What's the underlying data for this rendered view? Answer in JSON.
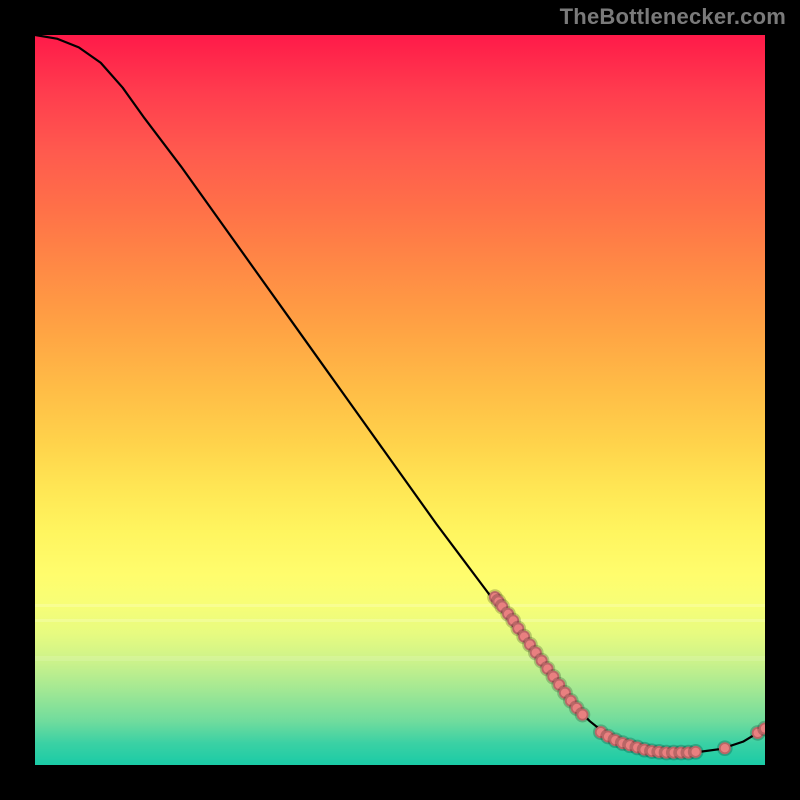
{
  "watermark": {
    "text": "TheBottlenecker.com"
  },
  "plot": {
    "width_units": 100,
    "height_units": 100
  },
  "chart_data": {
    "type": "line",
    "title": "",
    "xlabel": "",
    "ylabel": "",
    "xlim": [
      0,
      100
    ],
    "ylim": [
      0,
      100
    ],
    "background": "spectral-vertical-red-to-green",
    "curve": [
      {
        "x": 0,
        "y": 100.0
      },
      {
        "x": 3,
        "y": 99.5
      },
      {
        "x": 6,
        "y": 98.3
      },
      {
        "x": 9,
        "y": 96.2
      },
      {
        "x": 12,
        "y": 92.8
      },
      {
        "x": 15,
        "y": 88.6
      },
      {
        "x": 20,
        "y": 82.0
      },
      {
        "x": 25,
        "y": 75.0
      },
      {
        "x": 30,
        "y": 68.0
      },
      {
        "x": 35,
        "y": 61.0
      },
      {
        "x": 40,
        "y": 54.0
      },
      {
        "x": 45,
        "y": 47.0
      },
      {
        "x": 50,
        "y": 40.0
      },
      {
        "x": 55,
        "y": 33.0
      },
      {
        "x": 58,
        "y": 29.0
      },
      {
        "x": 61,
        "y": 25.0
      },
      {
        "x": 64,
        "y": 21.0
      },
      {
        "x": 67,
        "y": 17.0
      },
      {
        "x": 70,
        "y": 13.0
      },
      {
        "x": 73,
        "y": 9.0
      },
      {
        "x": 76,
        "y": 6.0
      },
      {
        "x": 79,
        "y": 3.6
      },
      {
        "x": 82,
        "y": 2.4
      },
      {
        "x": 85,
        "y": 1.8
      },
      {
        "x": 88,
        "y": 1.7
      },
      {
        "x": 91,
        "y": 1.8
      },
      {
        "x": 94,
        "y": 2.2
      },
      {
        "x": 97,
        "y": 3.2
      },
      {
        "x": 100,
        "y": 5.0
      }
    ],
    "scatter": [
      {
        "x": 63.0,
        "y": 23.0
      },
      {
        "x": 63.5,
        "y": 22.4
      },
      {
        "x": 64.0,
        "y": 21.7
      },
      {
        "x": 64.8,
        "y": 20.7
      },
      {
        "x": 65.5,
        "y": 19.8
      },
      {
        "x": 66.2,
        "y": 18.7
      },
      {
        "x": 67.0,
        "y": 17.6
      },
      {
        "x": 67.8,
        "y": 16.5
      },
      {
        "x": 68.6,
        "y": 15.4
      },
      {
        "x": 69.4,
        "y": 14.3
      },
      {
        "x": 70.2,
        "y": 13.2
      },
      {
        "x": 71.0,
        "y": 12.1
      },
      {
        "x": 71.8,
        "y": 11.0
      },
      {
        "x": 72.6,
        "y": 9.9
      },
      {
        "x": 73.4,
        "y": 8.8
      },
      {
        "x": 74.2,
        "y": 7.8
      },
      {
        "x": 75.0,
        "y": 6.9
      },
      {
        "x": 77.5,
        "y": 4.5
      },
      {
        "x": 78.5,
        "y": 3.9
      },
      {
        "x": 79.5,
        "y": 3.4
      },
      {
        "x": 80.5,
        "y": 3.0
      },
      {
        "x": 81.5,
        "y": 2.7
      },
      {
        "x": 82.5,
        "y": 2.4
      },
      {
        "x": 83.5,
        "y": 2.1
      },
      {
        "x": 84.5,
        "y": 1.9
      },
      {
        "x": 85.5,
        "y": 1.8
      },
      {
        "x": 86.5,
        "y": 1.7
      },
      {
        "x": 87.5,
        "y": 1.7
      },
      {
        "x": 88.5,
        "y": 1.7
      },
      {
        "x": 89.5,
        "y": 1.7
      },
      {
        "x": 90.5,
        "y": 1.8
      },
      {
        "x": 94.5,
        "y": 2.3
      },
      {
        "x": 99.0,
        "y": 4.4
      },
      {
        "x": 100.0,
        "y": 5.0
      }
    ],
    "dot_radius": 6
  }
}
